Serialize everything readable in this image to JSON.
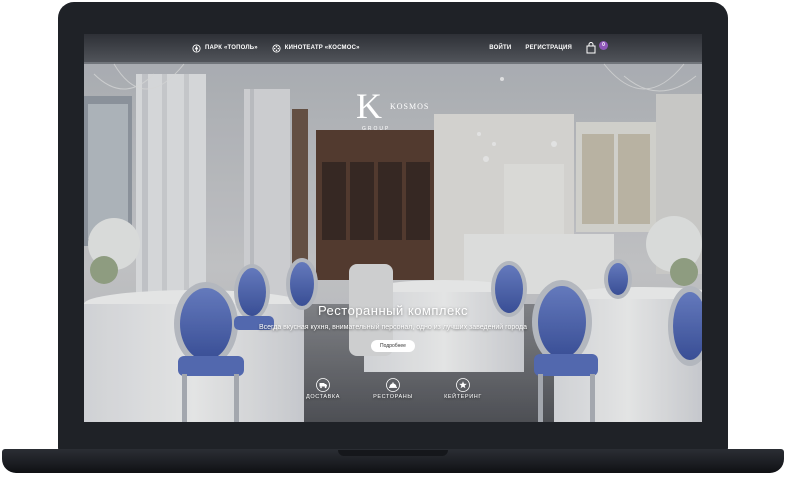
{
  "navbar": {
    "links": [
      {
        "label": "ПАРК «ТОПОЛЬ»",
        "icon": "park-icon"
      },
      {
        "label": "КИНОТЕАТР «КОСМОС»",
        "icon": "film-reel-icon"
      }
    ],
    "login_label": "ВОЙТИ",
    "register_label": "РЕГИСТРАЦИЯ",
    "cart": {
      "icon": "shopping-bag-icon",
      "count": "0",
      "badge_color": "#8e57b8"
    }
  },
  "logo": {
    "monogram": "K",
    "word": "KOSMOS",
    "group": "GROUP"
  },
  "hero": {
    "title": "Ресторанный комплекс",
    "subtitle": "Всегда вкусная кухня, внимательный персонал, одно из лучших заведений города",
    "more_label": "Подробнее"
  },
  "services": [
    {
      "label": "ДОСТАВКА",
      "icon": "delivery-icon"
    },
    {
      "label": "РЕСТОРАНЫ",
      "icon": "cloche-icon"
    },
    {
      "label": "КЕЙТЕРИНГ",
      "icon": "star-badge-icon"
    }
  ],
  "colors": {
    "chair_blue": "#5b72c2",
    "laptop_frame": "#1f2227",
    "accent": "#8e57b8"
  }
}
